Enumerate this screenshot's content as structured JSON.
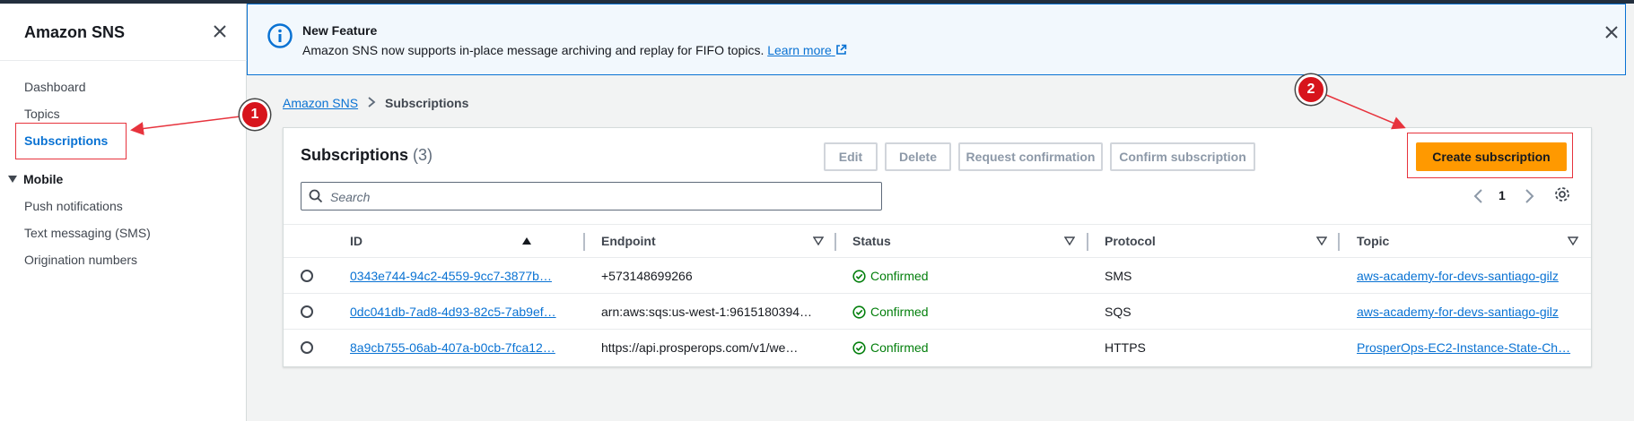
{
  "sidebar": {
    "title": "Amazon SNS",
    "items": [
      {
        "label": "Dashboard"
      },
      {
        "label": "Topics"
      },
      {
        "label": "Subscriptions"
      }
    ],
    "mobile_section": "Mobile",
    "mobile_items": [
      {
        "label": "Push notifications"
      },
      {
        "label": "Text messaging (SMS)"
      },
      {
        "label": "Origination numbers"
      }
    ]
  },
  "flash": {
    "title": "New Feature",
    "message": "Amazon SNS now supports in-place message archiving and replay for FIFO topics.",
    "link": "Learn more"
  },
  "breadcrumb": {
    "root": "Amazon SNS",
    "current": "Subscriptions"
  },
  "panel": {
    "title": "Subscriptions",
    "count": "(3)",
    "buttons": {
      "edit": "Edit",
      "delete": "Delete",
      "request_confirmation": "Request confirmation",
      "confirm_subscription": "Confirm subscription",
      "create_subscription": "Create subscription"
    },
    "search_placeholder": "Search",
    "page": "1"
  },
  "table": {
    "columns": [
      "ID",
      "Endpoint",
      "Status",
      "Protocol",
      "Topic"
    ],
    "rows": [
      {
        "id": "0343e744-94c2-4559-9cc7-3877b…",
        "endpoint": "+573148699266",
        "status": "Confirmed",
        "protocol": "SMS",
        "topic": "aws-academy-for-devs-santiago-gilz"
      },
      {
        "id": "0dc041db-7ad8-4d93-82c5-7ab9ef…",
        "endpoint": "arn:aws:sqs:us-west-1:9615180394…",
        "status": "Confirmed",
        "protocol": "SQS",
        "topic": "aws-academy-for-devs-santiago-gilz"
      },
      {
        "id": "8a9cb755-06ab-407a-b0cb-7fca12…",
        "endpoint": "https://api.prosperops.com/v1/we…",
        "status": "Confirmed",
        "protocol": "HTTPS",
        "topic": "ProsperOps-EC2-Instance-State-Ch…"
      }
    ]
  },
  "annotations": {
    "badge_1": "1",
    "badge_2": "2",
    "color": "#d7141c"
  },
  "colors": {
    "accent": "#0972d3",
    "primary_button": "#ff9900",
    "success": "#037f0c",
    "highlight": "#e7333d"
  }
}
